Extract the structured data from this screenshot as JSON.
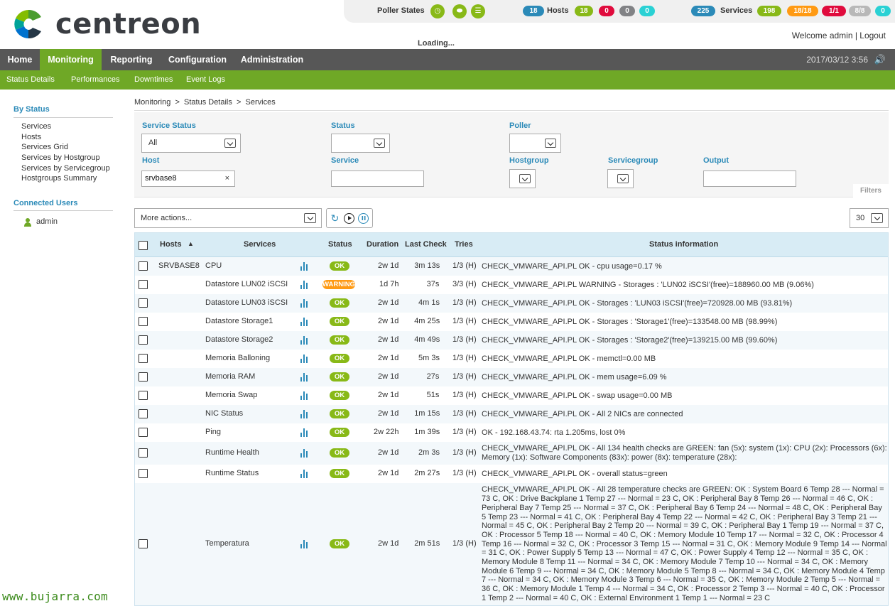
{
  "header": {
    "logo_text": "centreon",
    "poller_states_label": "Poller States",
    "hosts_total": "18",
    "hosts_label": "Hosts",
    "hosts_up": "18",
    "hosts_down": "0",
    "hosts_unreachable": "0",
    "hosts_pending": "0",
    "services_total": "225",
    "services_label": "Services",
    "services_ok": "198",
    "services_warning": "18/18",
    "services_critical": "1/1",
    "services_unknown": "8/8",
    "services_pending": "0",
    "loading_text": "Loading...",
    "welcome_text": "Welcome admin | Logout",
    "colors": {
      "ok": "#88b917",
      "warning": "#ff9a13",
      "critical": "#e00b3d",
      "unknown": "#818285",
      "pending": "#2ad1d4",
      "total": "#2b8ab8"
    }
  },
  "main_nav": {
    "tabs": [
      {
        "label": "Home"
      },
      {
        "label": "Monitoring"
      },
      {
        "label": "Reporting"
      },
      {
        "label": "Configuration"
      },
      {
        "label": "Administration"
      }
    ],
    "datetime": "2017/03/12 3:56",
    "sound_icon": "volume-icon"
  },
  "sub_nav": {
    "items": [
      "Status Details",
      "Performances",
      "Downtimes",
      "Event Logs"
    ]
  },
  "sidebar": {
    "by_status_heading": "By Status",
    "items": [
      "Services",
      "Hosts",
      "Services Grid",
      "Services by Hostgroup",
      "Services by Servicegroup",
      "Hostgroups Summary"
    ],
    "connected_heading": "Connected Users",
    "users": [
      "admin"
    ]
  },
  "footer_brand": "www.bujarra.com",
  "breadcrumb": "Monitoring  >  Status Details  >  Services",
  "filters": {
    "service_status_label": "Service Status",
    "service_status_value": "All",
    "status_label": "Status",
    "status_value": "",
    "poller_label": "Poller",
    "poller_value": "",
    "host_label": "Host",
    "host_value": "srvbase8",
    "service_label": "Service",
    "service_value": "",
    "hostgroup_label": "Hostgroup",
    "servicegroup_label": "Servicegroup",
    "output_label": "Output",
    "output_value": "",
    "filters_tab": "Filters"
  },
  "toolbar": {
    "more_actions": "More actions...",
    "per_page": "30"
  },
  "table": {
    "headers": {
      "hosts": "Hosts",
      "services": "Services",
      "status": "Status",
      "duration": "Duration",
      "last_check": "Last Check",
      "tries": "Tries",
      "status_info": "Status information"
    },
    "rows": [
      {
        "host": "SRVBASE8",
        "service": "CPU",
        "status": "OK",
        "duration": "2w 1d",
        "last_check": "3m 13s",
        "tries": "1/3 (H)",
        "info": "CHECK_VMWARE_API.PL OK - cpu usage=0.17 %"
      },
      {
        "host": "",
        "service": "Datastore LUN02 iSCSI",
        "status": "WARNING",
        "duration": "1d 7h",
        "last_check": "37s",
        "tries": "3/3 (H)",
        "info": "CHECK_VMWARE_API.PL WARNING - Storages : 'LUN02 iSCSI'(free)=188960.00 MB (9.06%)"
      },
      {
        "host": "",
        "service": "Datastore LUN03 iSCSI",
        "status": "OK",
        "duration": "2w 1d",
        "last_check": "4m 1s",
        "tries": "1/3 (H)",
        "info": "CHECK_VMWARE_API.PL OK - Storages : 'LUN03 iSCSI'(free)=720928.00 MB (93.81%)"
      },
      {
        "host": "",
        "service": "Datastore Storage1",
        "status": "OK",
        "duration": "2w 1d",
        "last_check": "4m 25s",
        "tries": "1/3 (H)",
        "info": "CHECK_VMWARE_API.PL OK - Storages : 'Storage1'(free)=133548.00 MB (98.99%)"
      },
      {
        "host": "",
        "service": "Datastore Storage2",
        "status": "OK",
        "duration": "2w 1d",
        "last_check": "4m 49s",
        "tries": "1/3 (H)",
        "info": "CHECK_VMWARE_API.PL OK - Storages : 'Storage2'(free)=139215.00 MB (99.60%)"
      },
      {
        "host": "",
        "service": "Memoria Balloning",
        "status": "OK",
        "duration": "2w 1d",
        "last_check": "5m 3s",
        "tries": "1/3 (H)",
        "info": "CHECK_VMWARE_API.PL OK - memctl=0.00 MB"
      },
      {
        "host": "",
        "service": "Memoria RAM",
        "status": "OK",
        "duration": "2w 1d",
        "last_check": "27s",
        "tries": "1/3 (H)",
        "info": "CHECK_VMWARE_API.PL OK - mem usage=6.09 %"
      },
      {
        "host": "",
        "service": "Memoria Swap",
        "status": "OK",
        "duration": "2w 1d",
        "last_check": "51s",
        "tries": "1/3 (H)",
        "info": "CHECK_VMWARE_API.PL OK - swap usage=0.00 MB"
      },
      {
        "host": "",
        "service": "NIC Status",
        "status": "OK",
        "duration": "2w 1d",
        "last_check": "1m 15s",
        "tries": "1/3 (H)",
        "info": "CHECK_VMWARE_API.PL OK - All 2 NICs are connected"
      },
      {
        "host": "",
        "service": "Ping",
        "status": "OK",
        "duration": "2w 22h",
        "last_check": "1m 39s",
        "tries": "1/3 (H)",
        "info": "OK - 192.168.43.74: rta 1.205ms, lost 0%"
      },
      {
        "host": "",
        "service": "Runtime Health",
        "status": "OK",
        "duration": "2w 1d",
        "last_check": "2m 3s",
        "tries": "1/3 (H)",
        "info": "CHECK_VMWARE_API.PL OK - All 134 health checks are GREEN: fan (5x): system (1x): CPU (2x): Processors (6x): Memory (1x): Software Components (83x): power (8x): temperature (28x):"
      },
      {
        "host": "",
        "service": "Runtime Status",
        "status": "OK",
        "duration": "2w 1d",
        "last_check": "2m 27s",
        "tries": "1/3 (H)",
        "info": "CHECK_VMWARE_API.PL OK - overall status=green"
      },
      {
        "host": "",
        "service": "Temperatura",
        "status": "OK",
        "duration": "2w 1d",
        "last_check": "2m 51s",
        "tries": "1/3 (H)",
        "info": "CHECK_VMWARE_API.PL OK - All 28 temperature checks are GREEN: OK : System Board 6 Temp 28 --- Normal = 73 C, OK : Drive Backplane 1 Temp 27 --- Normal = 23 C, OK : Peripheral Bay 8 Temp 26 --- Normal = 46 C, OK : Peripheral Bay 7 Temp 25 --- Normal = 37 C, OK : Peripheral Bay 6 Temp 24 --- Normal = 48 C, OK : Peripheral Bay 5 Temp 23 --- Normal = 41 C, OK : Peripheral Bay 4 Temp 22 --- Normal = 42 C, OK : Peripheral Bay 3 Temp 21 --- Normal = 45 C, OK : Peripheral Bay 2 Temp 20 --- Normal = 39 C, OK : Peripheral Bay 1 Temp 19 --- Normal = 37 C, OK : Processor 5 Temp 18 --- Normal = 40 C, OK : Memory Module 10 Temp 17 --- Normal = 32 C, OK : Processor 4 Temp 16 --- Normal = 32 C, OK : Processor 3 Temp 15 --- Normal = 31 C, OK : Memory Module 9 Temp 14 --- Normal = 31 C, OK : Power Supply 5 Temp 13 --- Normal = 47 C, OK : Power Supply 4 Temp 12 --- Normal = 35 C, OK : Memory Module 8 Temp 11 --- Normal = 34 C, OK : Memory Module 7 Temp 10 --- Normal = 34 C, OK : Memory Module 6 Temp 9 --- Normal = 34 C, OK : Memory Module 5 Temp 8 --- Normal = 34 C, OK : Memory Module 4 Temp 7 --- Normal = 34 C, OK : Memory Module 3 Temp 6 --- Normal = 35 C, OK : Memory Module 2 Temp 5 --- Normal = 36 C, OK : Memory Module 1 Temp 4 --- Normal = 34 C, OK : Processor 2 Temp 3 --- Normal = 40 C, OK : Processor 1 Temp 2 --- Normal = 40 C, OK : External Environment 1 Temp 1 --- Normal = 23 C"
      }
    ]
  }
}
